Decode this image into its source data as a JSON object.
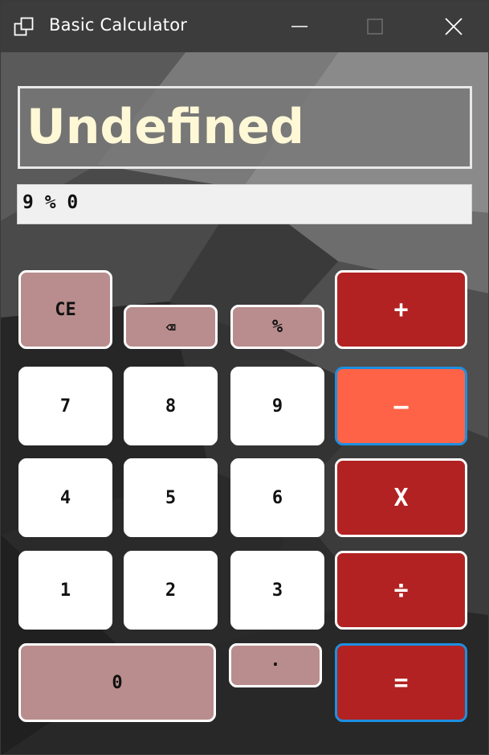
{
  "window": {
    "title": "Basic Calculator",
    "icon": "window-app-icon",
    "controls": {
      "minimize": "minimize-icon",
      "maximize": "maximize-icon",
      "close": "close-icon"
    }
  },
  "display": {
    "result": "Undefined",
    "expression": "9 % 0"
  },
  "keys": {
    "ce": "CE",
    "backspace": "⌫",
    "percent": "%",
    "plus": "+",
    "seven": "7",
    "eight": "8",
    "nine": "9",
    "minus": "–",
    "four": "4",
    "five": "5",
    "six": "6",
    "multiply": "X",
    "one": "1",
    "two": "2",
    "three": "3",
    "divide": "÷",
    "zero": "0",
    "decimal": "·",
    "equals": "="
  },
  "colors": {
    "operator": "#b22222",
    "operator_active": "#ff6347",
    "digit": "#ffffff",
    "function": "#b98d8d",
    "result_text": "#fff8d6"
  }
}
